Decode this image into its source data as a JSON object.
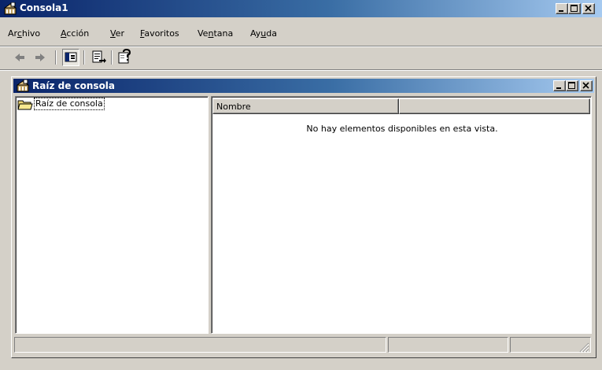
{
  "window": {
    "title": "Consola1"
  },
  "menubar": {
    "items": [
      {
        "pre": "Ar",
        "key": "c",
        "post": "hivo"
      },
      {
        "pre": "",
        "key": "A",
        "post": "cción"
      },
      {
        "pre": "",
        "key": "V",
        "post": "er"
      },
      {
        "pre": "",
        "key": "F",
        "post": "avoritos"
      },
      {
        "pre": "Ve",
        "key": "n",
        "post": "tana"
      },
      {
        "pre": "Ay",
        "key": "u",
        "post": "da"
      }
    ]
  },
  "toolbar": {
    "buttons": [
      "back-arrow-icon",
      "forward-arrow-icon",
      "show-hide-tree-icon",
      "export-list-icon",
      "help-icon"
    ]
  },
  "child_window": {
    "title": "Raíz de consola"
  },
  "tree": {
    "root_label": "Raíz de consola"
  },
  "list": {
    "columns": [
      "Nombre",
      ""
    ],
    "empty_message": "No hay elementos disponibles en esta vista."
  },
  "statusbar": {
    "panels": [
      "",
      "",
      ""
    ]
  }
}
